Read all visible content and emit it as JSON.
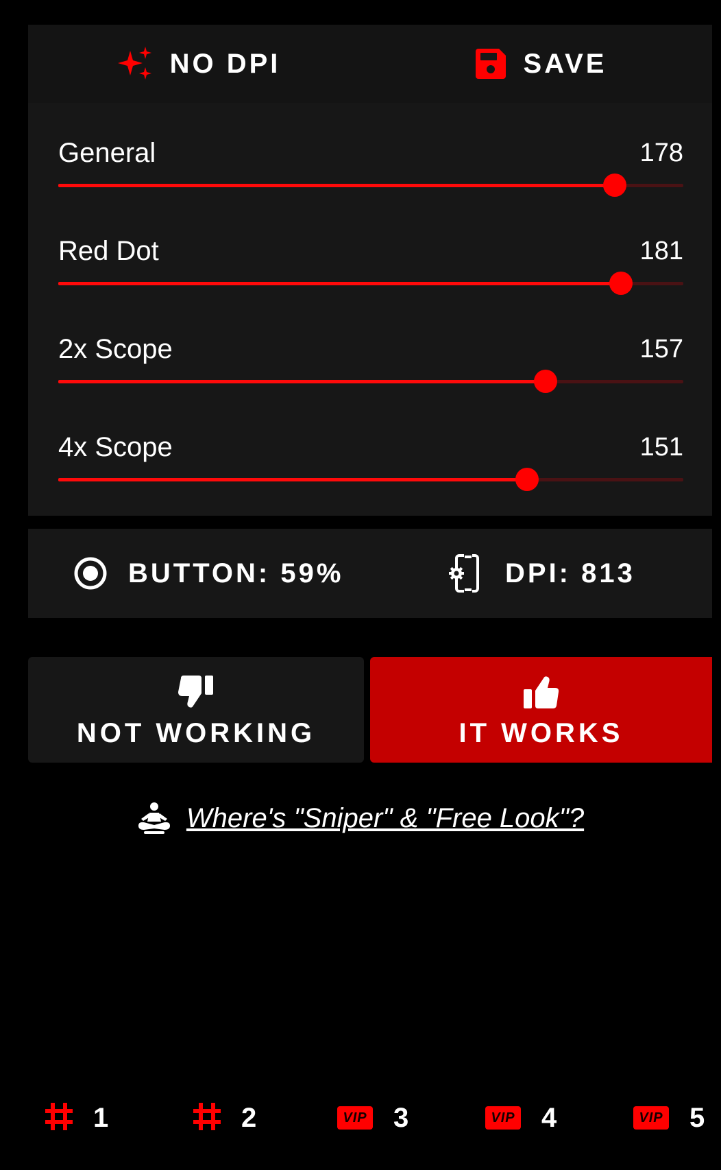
{
  "colors": {
    "accent": "#ff0000",
    "panel": "#171717",
    "primary_button": "#c40000",
    "background": "#000000"
  },
  "toolbar": {
    "no_dpi_label": "NO DPI",
    "no_dpi_icon": "sparkles-icon",
    "save_label": "SAVE",
    "save_icon": "floppy-disk-icon"
  },
  "sliders": [
    {
      "label": "General",
      "value": "178",
      "fraction": 0.89
    },
    {
      "label": "Red Dot",
      "value": "181",
      "fraction": 0.9
    },
    {
      "label": "2x Scope",
      "value": "157",
      "fraction": 0.78
    },
    {
      "label": "4x Scope",
      "value": "151",
      "fraction": 0.75
    }
  ],
  "info": {
    "button_text": "BUTTON: 59%",
    "button_icon": "radio-target-icon",
    "dpi_text": "DPI: 813",
    "dpi_icon": "phone-settings-icon"
  },
  "feedback": {
    "not_working_label": "NOT WORKING",
    "not_working_icon": "thumbs-down-icon",
    "it_works_label": "IT WORKS",
    "it_works_icon": "thumbs-up-icon"
  },
  "help": {
    "link_text": "Where's \"Sniper\" & \"Free Look\"?",
    "icon": "meditation-icon"
  },
  "nav": {
    "items": [
      {
        "badge": "#",
        "number": "1"
      },
      {
        "badge": "#",
        "number": "2"
      },
      {
        "badge": "VIP",
        "number": "3"
      },
      {
        "badge": "VIP",
        "number": "4"
      },
      {
        "badge": "VIP",
        "number": "5"
      }
    ]
  }
}
